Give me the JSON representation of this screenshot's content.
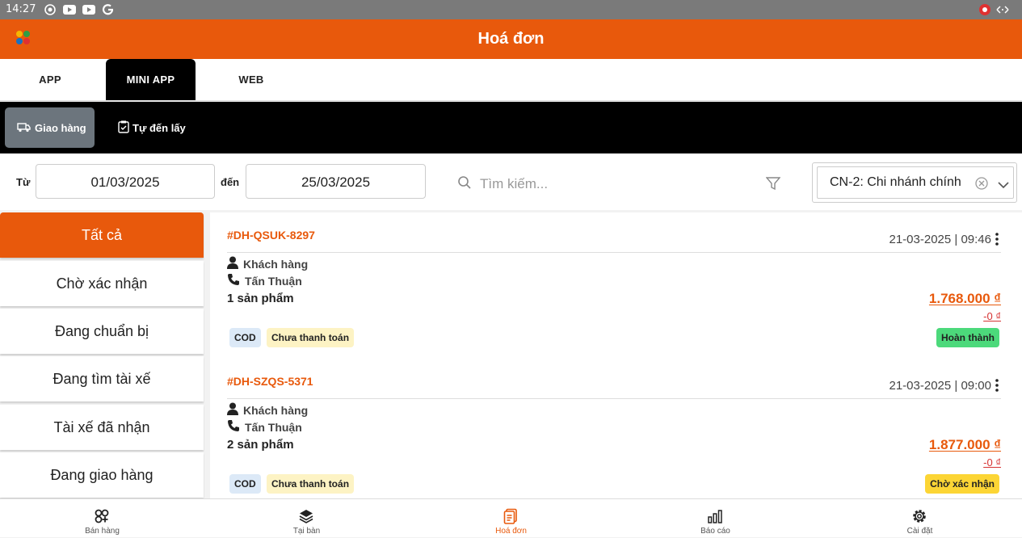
{
  "status": {
    "time": "14:27"
  },
  "header": {
    "title": "Hoá đơn"
  },
  "tabs": [
    {
      "label": "APP"
    },
    {
      "label": "MINI APP"
    },
    {
      "label": "WEB"
    }
  ],
  "subtabs": [
    {
      "label": "Giao hàng"
    },
    {
      "label": "Tự đến lấy"
    }
  ],
  "filters": {
    "from_label": "Từ",
    "from_value": "01/03/2025",
    "to_label": "đến",
    "to_value": "25/03/2025",
    "search_placeholder": "Tìm kiếm...",
    "branch_value": "CN-2: Chi nhánh chính"
  },
  "sidebar": {
    "items": [
      {
        "label": "Tất cả"
      },
      {
        "label": "Chờ xác nhận"
      },
      {
        "label": "Đang chuẩn bị"
      },
      {
        "label": "Đang tìm tài xế"
      },
      {
        "label": "Tài xế đã nhận"
      },
      {
        "label": "Đang giao hàng"
      }
    ]
  },
  "orders": [
    {
      "code": "#DH-QSUK-8297",
      "datetime": "21-03-2025 | 09:46",
      "customer": "Khách hàng",
      "phone_name": "Tấn Thuận",
      "product_count": "1 sản phẩm",
      "amount": "1.768.000 ₫",
      "discount": "-0 ₫",
      "payment_method": "COD",
      "payment_status": "Chưa thanh toán",
      "status": "Hoàn thành",
      "status_color": "#4cd97b"
    },
    {
      "code": "#DH-SZQS-5371",
      "datetime": "21-03-2025 | 09:00",
      "customer": "Khách hàng",
      "phone_name": "Tấn Thuận",
      "product_count": "2 sản phẩm",
      "amount": "1.877.000 ₫",
      "discount": "-0 ₫",
      "payment_method": "COD",
      "payment_status": "Chưa thanh toán",
      "status": "Chờ xác nhận",
      "status_color": "#fcd535"
    }
  ],
  "nav": [
    {
      "label": "Bán hàng",
      "icon": "grid-icon"
    },
    {
      "label": "Tại bàn",
      "icon": "layers-icon"
    },
    {
      "label": "Hoá đơn",
      "icon": "invoice-icon"
    },
    {
      "label": "Báo cáo",
      "icon": "chart-icon"
    },
    {
      "label": "Cài đặt",
      "icon": "gear-icon"
    }
  ],
  "colors": {
    "brand": "#e8590c",
    "cod_bg": "#dce9f7",
    "unpaid_bg": "#fdf3c4"
  }
}
